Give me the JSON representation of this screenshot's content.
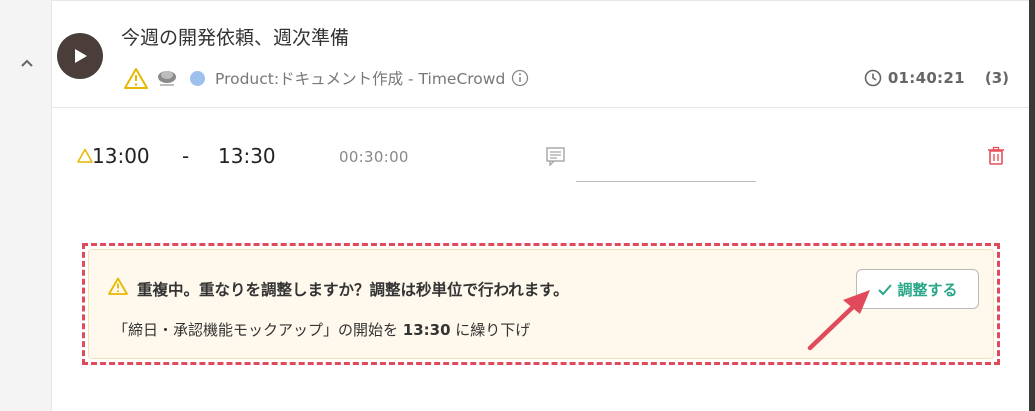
{
  "task": {
    "title": "今週の開発依頼、週次準備",
    "project": "Product:ドキュメント作成 - TimeCrowd",
    "duration": "01:40:21",
    "count": "(3)"
  },
  "entry": {
    "start": "13:00",
    "dash": "-",
    "end": "13:30",
    "duration": "00:30:00",
    "comment_value": ""
  },
  "alert": {
    "title": "重複中。重なりを調整しますか？調整は秒単位で行われます。",
    "desc_prefix": "「締日・承認機能モックアップ」の開始を ",
    "desc_time": "13:30",
    "desc_suffix": " に繰り下げ",
    "button_label": "調整する"
  },
  "colors": {
    "warning": "#e6b800",
    "accent_green": "#2aa788",
    "annotation_red": "#e04a5a",
    "project_dot": "#9ec0ec",
    "play_button": "#4a3d3a"
  }
}
